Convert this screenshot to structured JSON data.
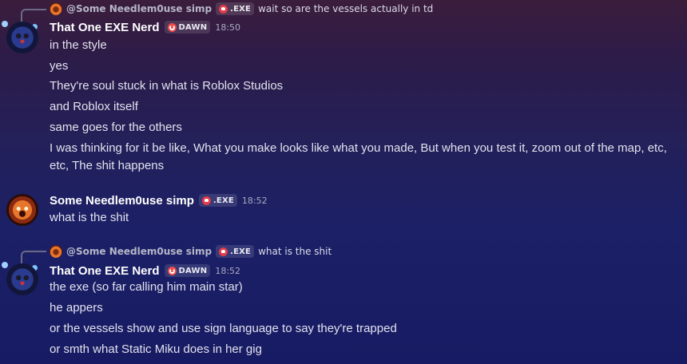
{
  "groups": [
    {
      "reply": {
        "author": "@Some Needlem0use simp",
        "tag": ".EXE",
        "text": "wait so are the vessels actually in td"
      },
      "author": "That One EXE Nerd",
      "tag": "DAWN",
      "time": "18:50",
      "lines": [
        "in the style",
        "yes",
        "They're soul stuck in what is Roblox Studios",
        "and Roblox itself",
        "same goes for the others",
        "I was thinking for it be like, What you make looks like what you made, But when you test it, zoom out of the map, etc,",
        "etc, The shit happens"
      ]
    },
    {
      "author": "Some Needlem0use simp",
      "tag": ".EXE",
      "time": "18:52",
      "lines": [
        "what is the shit"
      ]
    },
    {
      "reply": {
        "author": "@Some Needlem0use simp",
        "tag": ".EXE",
        "text": "what is the shit"
      },
      "author": "That One EXE Nerd",
      "tag": "DAWN",
      "time": "18:52",
      "lines": [
        "the exe (so far calling him main star)",
        "he appers",
        "or the vessels show and use sign language to say they're trapped",
        "or smth what Static Miku does in her gig"
      ]
    }
  ],
  "colors": {
    "username": "#ffffff",
    "tag_exe_icon": "#e23b4a",
    "tag_dawn_icon": "#f04a4a",
    "timestamp": "#a9a9c0"
  }
}
